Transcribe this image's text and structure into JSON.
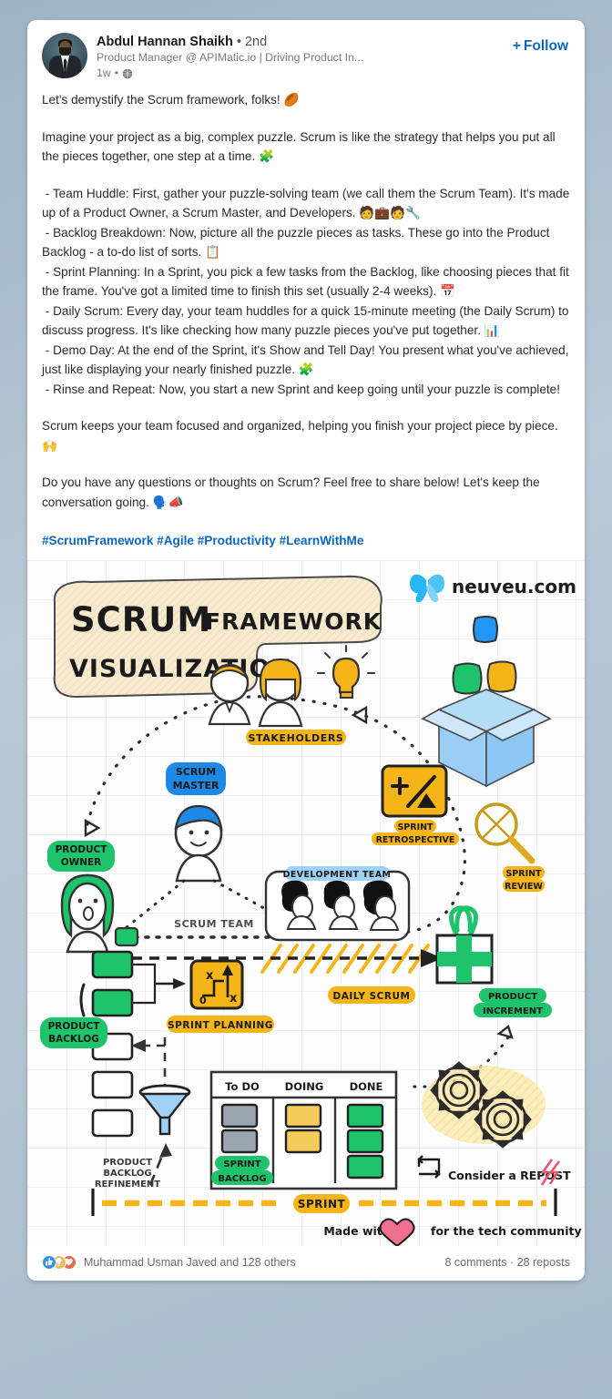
{
  "post": {
    "author": {
      "name": "Abdul Hannan Shaikh",
      "degree": "• 2nd",
      "headline": "Product Manager @ APIMatic.io | Driving Product In...",
      "time": "1w",
      "time_separator": "•",
      "visibility_icon": "globe-icon",
      "avatar_alt": "avatar"
    },
    "follow_label": "Follow",
    "follow_plus": "+",
    "accent_color": "#0a66c2",
    "text": {
      "line_1": "Let's demystify the Scrum framework, folks! 🏉",
      "para_2": "Imagine your project as a big, complex puzzle. Scrum is like the strategy that helps you put all the pieces together, one step at a time. 🧩",
      "bullet_1": " - Team Huddle: First, gather your puzzle-solving team (we call them the Scrum Team). It's made up of a Product Owner, a Scrum Master, and Developers. 🧑💼🧑🔧",
      "bullet_2": " - Backlog Breakdown: Now, picture all the puzzle pieces as tasks. These go into the Product Backlog - a to-do list of sorts. 📋",
      "bullet_3": " - Sprint Planning: In a Sprint, you pick a few tasks from the Backlog, like choosing pieces that fit the frame. You've got a limited time to finish this set (usually 2-4 weeks). 📅",
      "bullet_4": " - Daily Scrum: Every day, your team huddles for a quick 15-minute meeting (the Daily Scrum) to discuss progress. It's like checking how many puzzle pieces you've put together. 📊",
      "bullet_5": " - Demo Day: At the end of the Sprint, it's Show and Tell Day! You present what you've achieved, just like displaying your nearly finished puzzle. 🧩",
      "bullet_6": " - Rinse and Repeat: Now, you start a new Sprint and keep going until your puzzle is complete!",
      "para_closing": "Scrum keeps your team focused and organized, helping you finish your project piece by piece. 🙌",
      "para_cta": "Do you have any questions or thoughts on Scrum? Feel free to share below! Let's keep the conversation going. 🗣️📣",
      "hashtags": "#ScrumFramework #Agile #Productivity #LearnWithMe"
    }
  },
  "infographic": {
    "title_line_1_bold": "SCRUM",
    "title_line_1_rest": "FRAMEWORK",
    "title_line_2": "VISUALIZATION",
    "brand": "neuveu.com",
    "brand_icon": "butterfly-icon",
    "labels": {
      "stakeholders": "STAKEHOLDERS",
      "scrum_master": "SCRUM\nMASTER",
      "scrum_master_l1": "SCRUM",
      "scrum_master_l2": "MASTER",
      "product_owner_l1": "PRODUCT",
      "product_owner_l2": "OWNER",
      "scrum_team": "SCRUM TEAM",
      "development_team": "DEVELOPMENT TEAM",
      "sprint_retrospective_l1": "SPRINT",
      "sprint_retrospective_l2": "RETROSPECTIVE",
      "sprint_review_l1": "SPRINT",
      "sprint_review_l2": "REVIEW",
      "daily_scrum": "DAILY SCRUM",
      "product_increment_l1": "PRODUCT",
      "product_increment_l2": "INCREMENT",
      "sprint_planning": "SPRINT PLANNING",
      "product_backlog_l1": "PRODUCT",
      "product_backlog_l2": "BACKLOG",
      "product_backlog_refinement_l1": "PRODUCT",
      "product_backlog_refinement_l2": "BACKLOG",
      "product_backlog_refinement_l3": "REFINEMENT",
      "sprint_backlog_l1": "SPRINT",
      "sprint_backlog_l2": "BACKLOG",
      "sprint_bar": "SPRINT"
    },
    "board": {
      "columns": [
        "To DO",
        "DOING",
        "DONE"
      ],
      "todo_cards": 2,
      "doing_cards": 2,
      "done_cards": 3,
      "todo_color": "#9aa5b1",
      "doing_color": "#f5cb5c",
      "done_color": "#1fc36b"
    },
    "sprint_planning_icon_labels": [
      "x",
      "x",
      "0"
    ],
    "retrospective_icon_label": "+",
    "footer": {
      "repost_text": "Consider a REPOST",
      "repost_icon": "repost-icon",
      "made_with_prefix": "Made with",
      "made_with_suffix": "for the tech community",
      "heart_icon": "heart-icon",
      "lightning_icon": "lightning-icon"
    },
    "colors": {
      "green": "#1fc36b",
      "yellow": "#f5b417",
      "blue": "#2196f3",
      "light_blue": "#9fd0f5",
      "grid": "#e3eaf0",
      "cream": "#f5e7c0"
    }
  },
  "social": {
    "reaction_icons": [
      "like-icon",
      "insightful-icon",
      "love-icon"
    ],
    "reactions_text": "Muhammad Usman Javed and 128 others",
    "comments_reposts": "8 comments · 28 reposts"
  }
}
